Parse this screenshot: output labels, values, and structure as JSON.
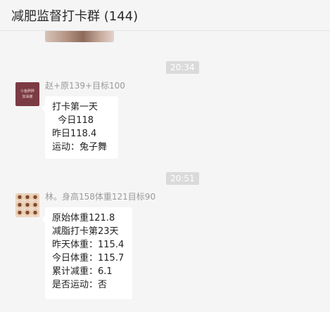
{
  "header": {
    "title": "减肥监督打卡群 (144)"
  },
  "timestamps": [
    "20:34",
    "20:51"
  ],
  "messages": [
    {
      "sender": "赵+原139+目标100",
      "avatar_text": [
        "小鱼胖胖",
        "加油瘦"
      ],
      "lines": [
        "打卡第一天",
        "  今日118",
        "昨日118.4",
        "运动：兔子舞"
      ]
    },
    {
      "sender": "林。身高158体重121目标90",
      "lines": [
        "原始体重121.8",
        "减脂打卡第23天",
        "昨天体重：115.4",
        "今日体重：115.7",
        "累计减重：6.1",
        "是否运动：否"
      ]
    }
  ]
}
